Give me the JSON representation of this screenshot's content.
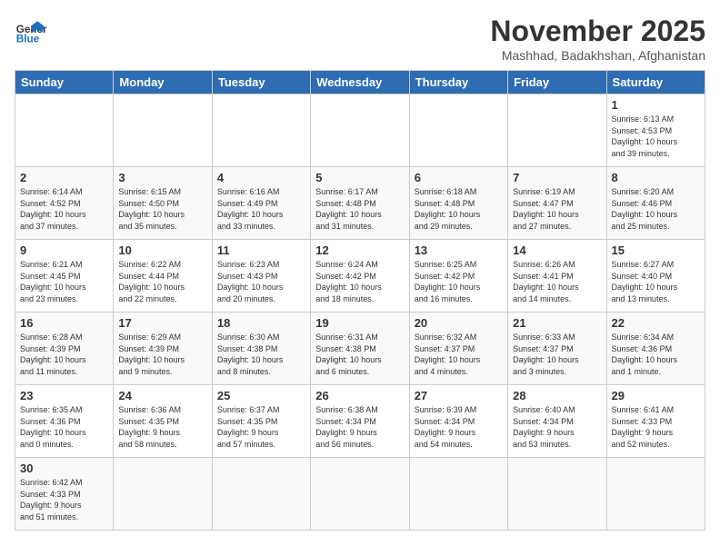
{
  "header": {
    "logo_general": "General",
    "logo_blue": "Blue",
    "month_title": "November 2025",
    "subtitle": "Mashhad, Badakhshan, Afghanistan"
  },
  "weekdays": [
    "Sunday",
    "Monday",
    "Tuesday",
    "Wednesday",
    "Thursday",
    "Friday",
    "Saturday"
  ],
  "weeks": [
    [
      {
        "day": "",
        "info": ""
      },
      {
        "day": "",
        "info": ""
      },
      {
        "day": "",
        "info": ""
      },
      {
        "day": "",
        "info": ""
      },
      {
        "day": "",
        "info": ""
      },
      {
        "day": "",
        "info": ""
      },
      {
        "day": "1",
        "info": "Sunrise: 6:13 AM\nSunset: 4:53 PM\nDaylight: 10 hours\nand 39 minutes."
      }
    ],
    [
      {
        "day": "2",
        "info": "Sunrise: 6:14 AM\nSunset: 4:52 PM\nDaylight: 10 hours\nand 37 minutes."
      },
      {
        "day": "3",
        "info": "Sunrise: 6:15 AM\nSunset: 4:50 PM\nDaylight: 10 hours\nand 35 minutes."
      },
      {
        "day": "4",
        "info": "Sunrise: 6:16 AM\nSunset: 4:49 PM\nDaylight: 10 hours\nand 33 minutes."
      },
      {
        "day": "5",
        "info": "Sunrise: 6:17 AM\nSunset: 4:48 PM\nDaylight: 10 hours\nand 31 minutes."
      },
      {
        "day": "6",
        "info": "Sunrise: 6:18 AM\nSunset: 4:48 PM\nDaylight: 10 hours\nand 29 minutes."
      },
      {
        "day": "7",
        "info": "Sunrise: 6:19 AM\nSunset: 4:47 PM\nDaylight: 10 hours\nand 27 minutes."
      },
      {
        "day": "8",
        "info": "Sunrise: 6:20 AM\nSunset: 4:46 PM\nDaylight: 10 hours\nand 25 minutes."
      }
    ],
    [
      {
        "day": "9",
        "info": "Sunrise: 6:21 AM\nSunset: 4:45 PM\nDaylight: 10 hours\nand 23 minutes."
      },
      {
        "day": "10",
        "info": "Sunrise: 6:22 AM\nSunset: 4:44 PM\nDaylight: 10 hours\nand 22 minutes."
      },
      {
        "day": "11",
        "info": "Sunrise: 6:23 AM\nSunset: 4:43 PM\nDaylight: 10 hours\nand 20 minutes."
      },
      {
        "day": "12",
        "info": "Sunrise: 6:24 AM\nSunset: 4:42 PM\nDaylight: 10 hours\nand 18 minutes."
      },
      {
        "day": "13",
        "info": "Sunrise: 6:25 AM\nSunset: 4:42 PM\nDaylight: 10 hours\nand 16 minutes."
      },
      {
        "day": "14",
        "info": "Sunrise: 6:26 AM\nSunset: 4:41 PM\nDaylight: 10 hours\nand 14 minutes."
      },
      {
        "day": "15",
        "info": "Sunrise: 6:27 AM\nSunset: 4:40 PM\nDaylight: 10 hours\nand 13 minutes."
      }
    ],
    [
      {
        "day": "16",
        "info": "Sunrise: 6:28 AM\nSunset: 4:39 PM\nDaylight: 10 hours\nand 11 minutes."
      },
      {
        "day": "17",
        "info": "Sunrise: 6:29 AM\nSunset: 4:39 PM\nDaylight: 10 hours\nand 9 minutes."
      },
      {
        "day": "18",
        "info": "Sunrise: 6:30 AM\nSunset: 4:38 PM\nDaylight: 10 hours\nand 8 minutes."
      },
      {
        "day": "19",
        "info": "Sunrise: 6:31 AM\nSunset: 4:38 PM\nDaylight: 10 hours\nand 6 minutes."
      },
      {
        "day": "20",
        "info": "Sunrise: 6:32 AM\nSunset: 4:37 PM\nDaylight: 10 hours\nand 4 minutes."
      },
      {
        "day": "21",
        "info": "Sunrise: 6:33 AM\nSunset: 4:37 PM\nDaylight: 10 hours\nand 3 minutes."
      },
      {
        "day": "22",
        "info": "Sunrise: 6:34 AM\nSunset: 4:36 PM\nDaylight: 10 hours\nand 1 minute."
      }
    ],
    [
      {
        "day": "23",
        "info": "Sunrise: 6:35 AM\nSunset: 4:36 PM\nDaylight: 10 hours\nand 0 minutes."
      },
      {
        "day": "24",
        "info": "Sunrise: 6:36 AM\nSunset: 4:35 PM\nDaylight: 9 hours\nand 58 minutes."
      },
      {
        "day": "25",
        "info": "Sunrise: 6:37 AM\nSunset: 4:35 PM\nDaylight: 9 hours\nand 57 minutes."
      },
      {
        "day": "26",
        "info": "Sunrise: 6:38 AM\nSunset: 4:34 PM\nDaylight: 9 hours\nand 56 minutes."
      },
      {
        "day": "27",
        "info": "Sunrise: 6:39 AM\nSunset: 4:34 PM\nDaylight: 9 hours\nand 54 minutes."
      },
      {
        "day": "28",
        "info": "Sunrise: 6:40 AM\nSunset: 4:34 PM\nDaylight: 9 hours\nand 53 minutes."
      },
      {
        "day": "29",
        "info": "Sunrise: 6:41 AM\nSunset: 4:33 PM\nDaylight: 9 hours\nand 52 minutes."
      }
    ],
    [
      {
        "day": "30",
        "info": "Sunrise: 6:42 AM\nSunset: 4:33 PM\nDaylight: 9 hours\nand 51 minutes."
      },
      {
        "day": "",
        "info": ""
      },
      {
        "day": "",
        "info": ""
      },
      {
        "day": "",
        "info": ""
      },
      {
        "day": "",
        "info": ""
      },
      {
        "day": "",
        "info": ""
      },
      {
        "day": "",
        "info": ""
      }
    ]
  ]
}
